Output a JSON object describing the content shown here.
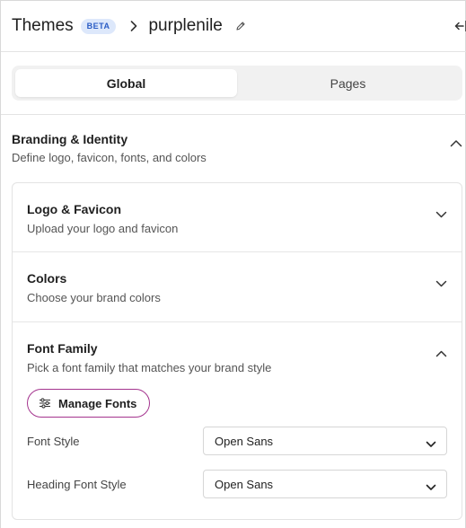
{
  "header": {
    "app_title": "Themes",
    "badge": "BETA",
    "theme_name": "purplenile"
  },
  "tabs": [
    {
      "label": "Global",
      "active": true
    },
    {
      "label": "Pages",
      "active": false
    }
  ],
  "section": {
    "title": "Branding & Identity",
    "subtitle": "Define logo, favicon, fonts, and colors",
    "expanded": true
  },
  "items": [
    {
      "title": "Logo & Favicon",
      "subtitle": "Upload your logo and favicon",
      "expanded": false
    },
    {
      "title": "Colors",
      "subtitle": "Choose your brand colors",
      "expanded": false
    },
    {
      "title": "Font Family",
      "subtitle": "Pick a font family that matches your brand style",
      "expanded": true
    }
  ],
  "font_family": {
    "manage_label": "Manage Fonts",
    "font_style_label": "Font Style",
    "font_style_value": "Open Sans",
    "heading_font_label": "Heading Font Style",
    "heading_font_value": "Open Sans"
  },
  "colors": {
    "accent_border": "#a4348e",
    "badge_bg": "#dde8fb",
    "badge_text": "#2a5cc4"
  },
  "icons": [
    "chevron-right-icon",
    "pencil-icon",
    "collapse-panel-icon",
    "chevron-up-icon",
    "chevron-down-icon",
    "sliders-icon"
  ]
}
